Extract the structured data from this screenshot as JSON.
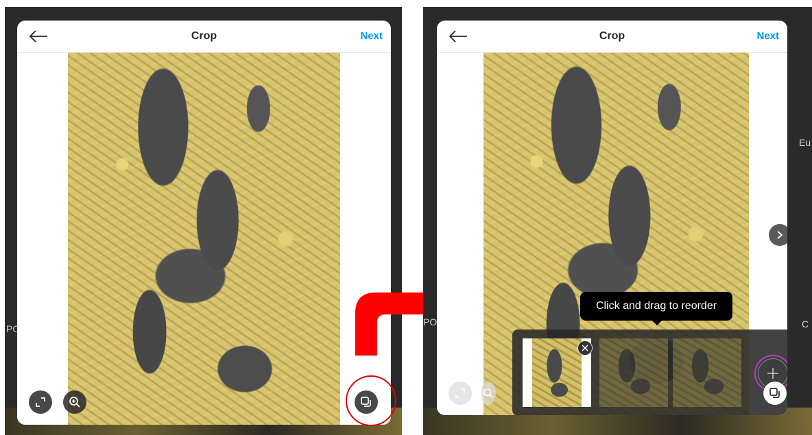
{
  "left_panel": {
    "title": "Crop",
    "next_label": "Next",
    "side_text_left": "PO",
    "side_text_right": ""
  },
  "right_panel": {
    "title": "Crop",
    "next_label": "Next",
    "tooltip": "Click and drag to reorder",
    "side_text_left": "PO",
    "side_text_right": "Eu",
    "side_text_right_lower": "C",
    "carousel": {
      "current": 1,
      "total": 3
    }
  },
  "icons": {
    "back": "back-arrow-icon",
    "expand": "expand-icon",
    "zoom": "zoom-in-icon",
    "gallery": "multiple-select-icon",
    "next_slide": "chevron-right-icon",
    "remove": "close-icon",
    "add": "plus-icon"
  },
  "colors": {
    "accent": "#0095f6",
    "highlight": "#e00000",
    "arrow": "#ff0000",
    "photo_yellow": "#d9c46a",
    "photo_gray": "#4a4a4a"
  }
}
